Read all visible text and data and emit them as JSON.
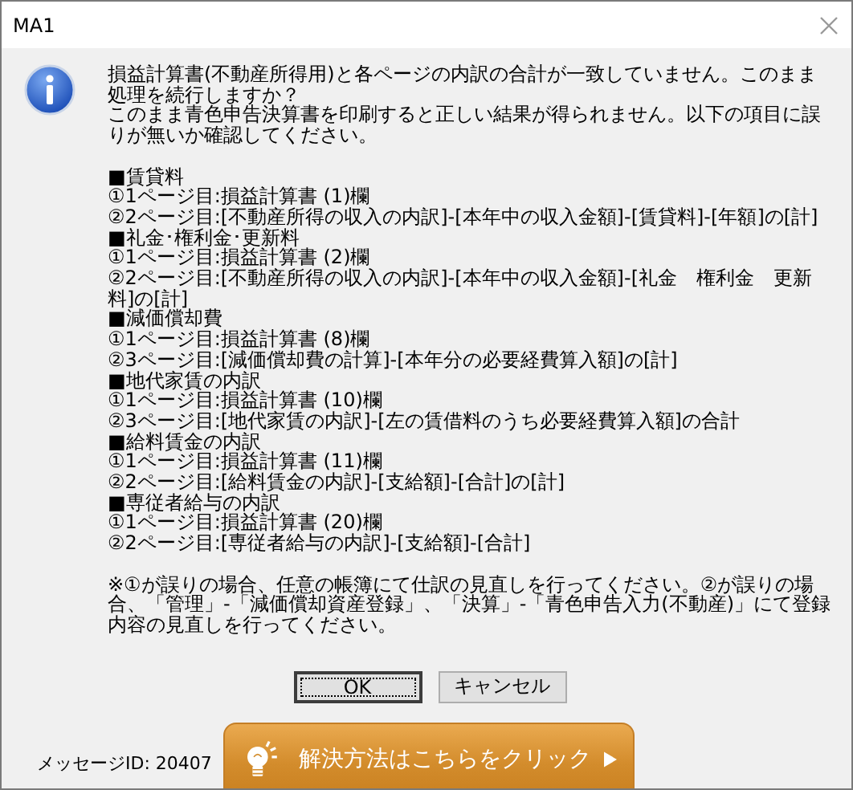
{
  "window": {
    "title": "MA1"
  },
  "message": {
    "intro": [
      "損益計算書(不動産所得用)と各ページの内訳の合計が一致していません。このまま処理を続行しますか？",
      "このまま青色申告決算書を印刷すると正しい結果が得られません。以下の項目に誤りが無いか確認してください。"
    ],
    "sections": [
      {
        "heading": "■賃貸料",
        "lines": [
          "①1ページ目:損益計算書 (1)欄",
          "②2ページ目:[不動産所得の収入の内訳]-[本年中の収入金額]-[賃貸料]-[年額]の[計]"
        ]
      },
      {
        "heading": "■礼金･権利金･更新料",
        "lines": [
          "①1ページ目:損益計算書 (2)欄",
          "②2ページ目:[不動産所得の収入の内訳]-[本年中の収入金額]-[礼金　権利金　更新料]の[計]"
        ]
      },
      {
        "heading": "■減価償却費",
        "lines": [
          "①1ページ目:損益計算書 (8)欄",
          "②3ページ目:[減価償却費の計算]-[本年分の必要経費算入額]の[計]"
        ]
      },
      {
        "heading": "■地代家賃の内訳",
        "lines": [
          "①1ページ目:損益計算書 (10)欄",
          "②3ページ目:[地代家賃の内訳]-[左の賃借料のうち必要経費算入額]の合計"
        ]
      },
      {
        "heading": "■給料賃金の内訳",
        "lines": [
          "①1ページ目:損益計算書 (11)欄",
          "②2ページ目:[給料賃金の内訳]-[支給額]-[合計]の[計]"
        ]
      },
      {
        "heading": "■専従者給与の内訳",
        "lines": [
          "①1ページ目:損益計算書 (20)欄",
          "②2ページ目:[専従者給与の内訳]-[支給額]-[合計]"
        ]
      }
    ],
    "note": "※①が誤りの場合、任意の帳簿にて仕訳の見直しを行ってください。②が誤りの場合、「管理」-「減価償却資産登録」、「決算」-「青色申告入力(不動産)」にて登録内容の見直しを行ってください。"
  },
  "buttons": [
    {
      "label": "OK",
      "selected": true
    },
    {
      "label": "キャンセル",
      "selected": false
    }
  ],
  "message_id": "メッセージID: 20407",
  "help_button": {
    "label": "解決方法はこちらをクリック"
  }
}
